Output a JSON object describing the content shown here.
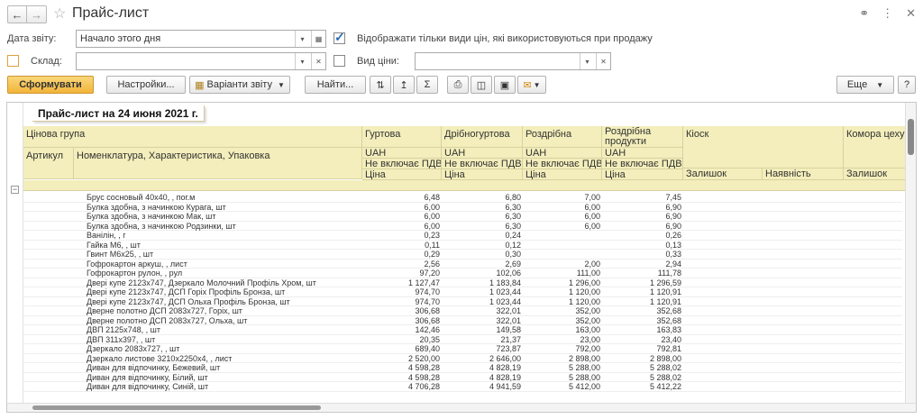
{
  "window": {
    "title": "Прайс-лист"
  },
  "filters": {
    "date_label": "Дата звіту:",
    "date_value": "Начало этого дня",
    "only_used_label": "Відображати тільки види цін, які використовуються при продажу",
    "warehouse_label": "Склад:",
    "price_type_label": "Вид ціни:"
  },
  "toolbar": {
    "generate": "Сформувати",
    "settings": "Настройки...",
    "variants": "Варіанти звіту",
    "find": "Найти...",
    "more": "Еще",
    "help": "?"
  },
  "report": {
    "title": "Прайс-лист на 24 июня 2021 г.",
    "headers": {
      "price_group": "Цінова група",
      "article": "Артикул",
      "nomenclature": "Номенклатура, Характеристика, Упаковка",
      "wholesale": "Гуртова",
      "small_wholesale": "Дрібногуртова",
      "retail": "Роздрібна",
      "retail_products_1": "Роздрібна",
      "retail_products_2": "продукти",
      "kiosk": "Кіоск",
      "komora": "Комора цеху м",
      "currency": "UAH",
      "vat": "Не включає ПДВ",
      "price": "Ціна",
      "balance": "Залишок",
      "availability": "Наявність"
    },
    "rows": [
      {
        "name": "Брус сосновый 40х40, , пог.м",
        "w": "6,48",
        "s": "6,80",
        "r": "7,00",
        "p": "7,45"
      },
      {
        "name": "Булка здобна, з начинкою Курага, шт",
        "w": "6,00",
        "s": "6,30",
        "r": "6,00",
        "p": "6,90"
      },
      {
        "name": "Булка здобна, з начинкою Мак, шт",
        "w": "6,00",
        "s": "6,30",
        "r": "6,00",
        "p": "6,90"
      },
      {
        "name": "Булка здобна, з начинкою Родзинки, шт",
        "w": "6,00",
        "s": "6,30",
        "r": "6,00",
        "p": "6,90"
      },
      {
        "name": "Ванілін, , г",
        "w": "0,23",
        "s": "0,24",
        "r": "",
        "p": "0,26"
      },
      {
        "name": "Гайка М6, , шт",
        "w": "0,11",
        "s": "0,12",
        "r": "",
        "p": "0,13"
      },
      {
        "name": "Гвинт М6х25, , шт",
        "w": "0,29",
        "s": "0,30",
        "r": "",
        "p": "0,33"
      },
      {
        "name": "Гофрокартон аркуш, , лист",
        "w": "2,56",
        "s": "2,69",
        "r": "2,00",
        "p": "2,94"
      },
      {
        "name": "Гофрокартон рулон, , рул",
        "w": "97,20",
        "s": "102,06",
        "r": "111,00",
        "p": "111,78"
      },
      {
        "name": "Двері купе 2123х747, Дзеркало Молочний Профіль Хром, шт",
        "w": "1 127,47",
        "s": "1 183,84",
        "r": "1 296,00",
        "p": "1 296,59"
      },
      {
        "name": "Двері купе 2123х747, ДСП Горіх Профіль Бронза, шт",
        "w": "974,70",
        "s": "1 023,44",
        "r": "1 120,00",
        "p": "1 120,91"
      },
      {
        "name": "Двері купе 2123х747, ДСП Ольха Профіль Бронза, шт",
        "w": "974,70",
        "s": "1 023,44",
        "r": "1 120,00",
        "p": "1 120,91"
      },
      {
        "name": "Дверне полотно ДСП 2083х727, Горіх, шт",
        "w": "306,68",
        "s": "322,01",
        "r": "352,00",
        "p": "352,68"
      },
      {
        "name": "Дверне полотно ДСП 2083х727, Ольха, шт",
        "w": "306,68",
        "s": "322,01",
        "r": "352,00",
        "p": "352,68"
      },
      {
        "name": "ДВП 2125х748, , шт",
        "w": "142,46",
        "s": "149,58",
        "r": "163,00",
        "p": "163,83"
      },
      {
        "name": "ДВП 311х397, , шт",
        "w": "20,35",
        "s": "21,37",
        "r": "23,00",
        "p": "23,40"
      },
      {
        "name": "Дзеркало 2083х727, , шт",
        "w": "689,40",
        "s": "723,87",
        "r": "792,00",
        "p": "792,81"
      },
      {
        "name": "Дзеркало листове 3210х2250х4, , лист",
        "w": "2 520,00",
        "s": "2 646,00",
        "r": "2 898,00",
        "p": "2 898,00"
      },
      {
        "name": "Диван для відпочинку, Бежевий, шт",
        "w": "4 598,28",
        "s": "4 828,19",
        "r": "5 288,00",
        "p": "5 288,02"
      },
      {
        "name": "Диван для відпочинку, Білий, шт",
        "w": "4 598,28",
        "s": "4 828,19",
        "r": "5 288,00",
        "p": "5 288,02"
      },
      {
        "name": "Диван для відпочинку, Синій, шт",
        "w": "4 706,28",
        "s": "4 941,59",
        "r": "5 412,00",
        "p": "5 412,22"
      }
    ]
  }
}
